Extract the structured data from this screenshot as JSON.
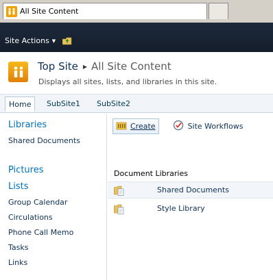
{
  "browser": {
    "tab_title": "All Site Content"
  },
  "actionbar": {
    "site_actions_label": "Site Actions"
  },
  "titlearea": {
    "site_name": "Top Site",
    "page_name": "All Site Content",
    "description": "Displays all sites, lists, and libraries in this site."
  },
  "topnav": {
    "items": [
      {
        "label": "Home"
      },
      {
        "label": "SubSite1"
      },
      {
        "label": "SubSite2"
      }
    ]
  },
  "quicklaunch": {
    "libraries_header": "Libraries",
    "libraries": [
      {
        "label": "Shared Documents"
      }
    ],
    "pictures_header": "Pictures",
    "lists_header": "Lists",
    "lists": [
      {
        "label": "Group Calendar"
      },
      {
        "label": "Circulations"
      },
      {
        "label": "Phone Call Memo"
      },
      {
        "label": "Tasks"
      },
      {
        "label": "Links"
      }
    ]
  },
  "main": {
    "create_label": "Create",
    "workflows_label": "Site Workflows",
    "section_title": "Document Libraries",
    "libraries": [
      {
        "label": "Shared Documents"
      },
      {
        "label": "Style Library"
      }
    ]
  },
  "colors": {
    "actionbar_bg": "#1d2a3d",
    "link": "#0d2f52",
    "quicklaunch_header": "#0072bc",
    "logo_orange": "#f0a000"
  },
  "icons": {
    "favicon": "sharepoint-icon",
    "nav_up": "folder-up-icon",
    "site_logo": "sharepoint-logo-icon",
    "create": "create-icon",
    "workflows": "workflow-icon",
    "library": "document-library-icon"
  }
}
